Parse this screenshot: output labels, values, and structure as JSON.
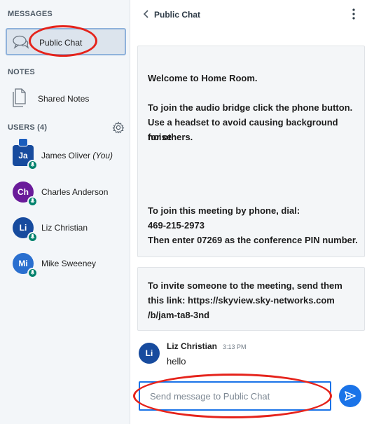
{
  "sidebar": {
    "messages_title": "MESSAGES",
    "public_chat_label": "Public Chat",
    "notes_title": "NOTES",
    "shared_notes_label": "Shared Notes",
    "users_title": "USERS (4)",
    "users": [
      {
        "initials": "Ja",
        "name": "James Oliver",
        "suffix": "(You)",
        "color": "#174b9e",
        "presenter": true
      },
      {
        "initials": "Ch",
        "name": "Charles Anderson",
        "color": "#6a1b9a"
      },
      {
        "initials": "Li",
        "name": "Liz Christian",
        "color": "#174b9e"
      },
      {
        "initials": "Mi",
        "name": "Mike Sweeney",
        "color": "#2a6fcf"
      }
    ]
  },
  "header": {
    "title": "Public Chat"
  },
  "welcome": {
    "welcome_prefix": "Welcome to ",
    "room_name": "Home Room",
    "welcome_suffix": ".",
    "audio_line1": "To join the audio bridge click the phone button.",
    "audio_line2": "Use a headset to avoid causing background noise",
    "audio_line3": "for others.",
    "phone_line1": "To join this meeting by phone, dial:",
    "phone_number": "469-215-2973",
    "phone_line3": "Then enter 07269 as the conference PIN number."
  },
  "invite": {
    "line1": "To invite someone to the meeting, send them",
    "line2": "this link: https://skyview.sky-networks.com",
    "line3": "/b/jam-ta8-3nd"
  },
  "chat": {
    "author_initials": "Li",
    "author": "Liz Christian",
    "time": "3:13 PM",
    "text": "hello"
  },
  "composer": {
    "placeholder": "Send message to Public Chat"
  },
  "colors": {
    "accent": "#1a73e8",
    "annotation": "#e5231b",
    "mic_badge": "#00816c"
  }
}
